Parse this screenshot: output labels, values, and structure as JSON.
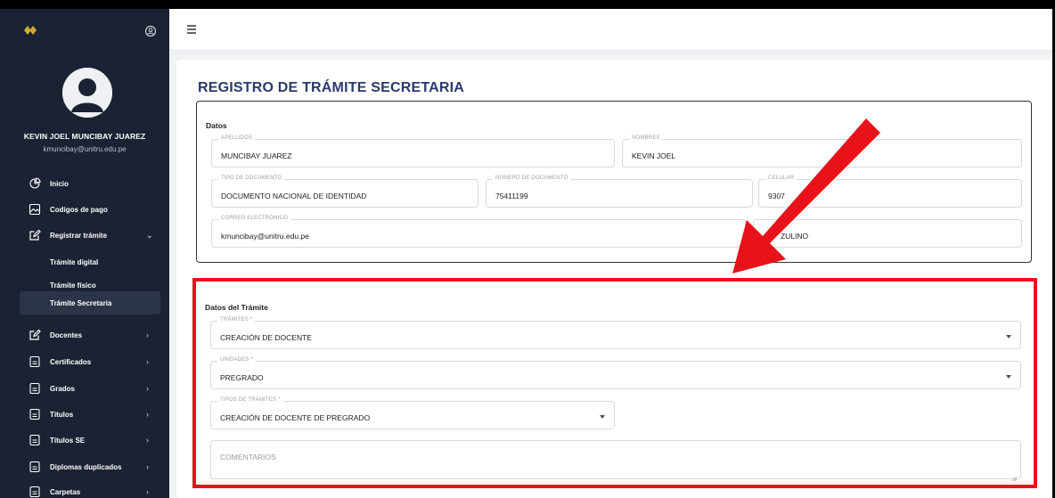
{
  "sidebar": {
    "user_name": "KEVIN JOEL MUNCIBAY JUAREZ",
    "user_email": "kmuncibay@unitru.edu.pe",
    "items": [
      {
        "label": "Inicio",
        "icon": "pie-chart-icon"
      },
      {
        "label": "Codigos de pago",
        "icon": "image-icon"
      },
      {
        "label": "Registrar trámite",
        "icon": "edit-icon",
        "expanded": true
      },
      {
        "label": "Trámite digital"
      },
      {
        "label": "Trámite físico"
      },
      {
        "label": "Trámite Secretaria",
        "active": true
      },
      {
        "label": "Docentes",
        "icon": "edit-icon"
      },
      {
        "label": "Certificados",
        "icon": "document-icon"
      },
      {
        "label": "Grados",
        "icon": "document-icon"
      },
      {
        "label": "Títulos",
        "icon": "document-icon"
      },
      {
        "label": "Títulos SE",
        "icon": "document-icon"
      },
      {
        "label": "Diplomas duplicados",
        "icon": "document-icon"
      },
      {
        "label": "Carpetas",
        "icon": "document-icon"
      }
    ]
  },
  "page": {
    "title": "REGISTRO DE TRÁMITE SECRETARIA"
  },
  "datos": {
    "section_title": "Datos",
    "apellidos_label": "APELLIDOS",
    "apellidos_value": "MUNCIBAY JUAREZ",
    "nombres_label": "NOMBRES",
    "nombres_value": "KEVIN JOEL",
    "tipo_doc_label": "TIPO DE DOCUMENTO",
    "tipo_doc_value": "DOCUMENTO NACIONAL DE IDENTIDAD",
    "num_doc_label": "NÚMERO DE DOCUMENTO",
    "num_doc_value": "75411199",
    "celular_label": "CELULAR",
    "celular_value": "9307",
    "correo_label": "CORREO ELECTRÓNICO",
    "correo_value": "kmuncibay@unitru.edu.pe",
    "extra_value": "ZULINO"
  },
  "tramite": {
    "section_title": "Datos del Trámite",
    "tramites_label": "TRÁMITES *",
    "tramites_value": "CREACIÓN DE DOCENTE",
    "unidades_label": "UNIDADES *",
    "unidades_value": "PREGRADO",
    "tipos_label": "TIPOS DE TRÁMITES *",
    "tipos_value": "CREACIÓN DE DOCENTE DE PREGRADO",
    "comentarios_placeholder": "COMENTARIOS"
  },
  "colors": {
    "sidebar_bg": "#1a2233",
    "title_color": "#2b3a6e",
    "highlight": "#e8121a"
  }
}
